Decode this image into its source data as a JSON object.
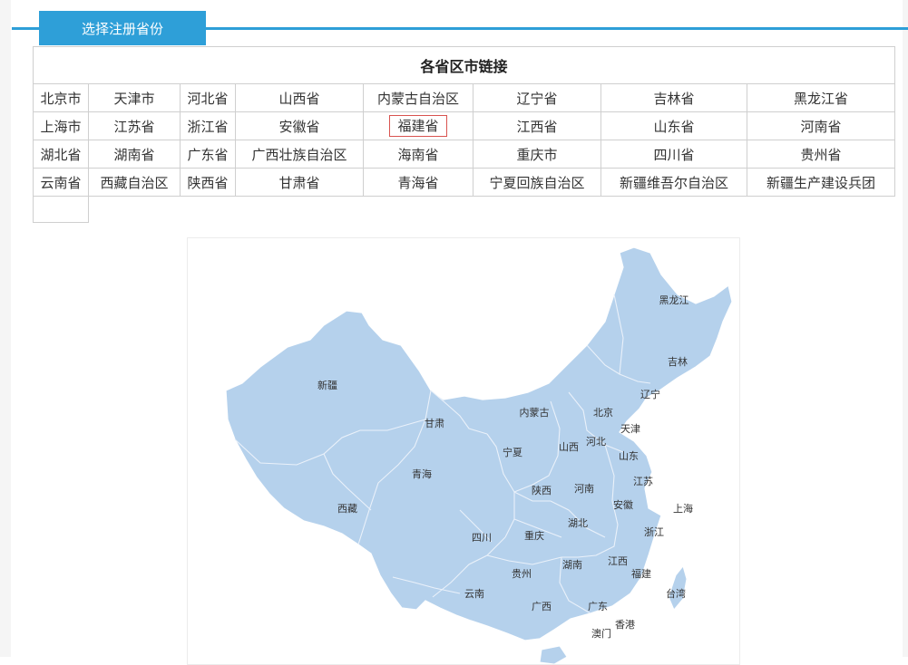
{
  "tab": {
    "label": "选择注册省份"
  },
  "table": {
    "title": "各省区市链接",
    "rows": [
      [
        "北京市",
        "天津市",
        "河北省",
        "山西省",
        "内蒙古自治区",
        "辽宁省",
        "吉林省",
        "黑龙江省"
      ],
      [
        "上海市",
        "江苏省",
        "浙江省",
        "安徽省",
        "福建省",
        "江西省",
        "山东省",
        "河南省"
      ],
      [
        "湖北省",
        "湖南省",
        "广东省",
        "广西壮族自治区",
        "海南省",
        "重庆市",
        "四川省",
        "贵州省"
      ],
      [
        "云南省",
        "西藏自治区",
        "陕西省",
        "甘肃省",
        "青海省",
        "宁夏回族自治区",
        "新疆维吾尔自治区",
        "新疆生产建设兵团"
      ]
    ],
    "highlighted": "福建省"
  },
  "map": {
    "fill_color": "#b5d1ec",
    "border_color": "#e6eef8",
    "labels": {
      "heilongjiang": "黑龙江",
      "jilin": "吉林",
      "liaoning": "辽宁",
      "xinjiang": "新疆",
      "neimenggu": "内蒙古",
      "beijing": "北京",
      "tianjin": "天津",
      "gansu": "甘肃",
      "hebei": "河北",
      "ningxia": "宁夏",
      "shanxi": "山西",
      "shandong": "山东",
      "qinghai": "青海",
      "jiangsu": "江苏",
      "shaanxi": "陕西",
      "henan": "河南",
      "xizang": "西藏",
      "anhui": "安徽",
      "shanghai": "上海",
      "hubei": "湖北",
      "zhejiang": "浙江",
      "sichuan": "四川",
      "chongqing": "重庆",
      "guizhou": "贵州",
      "hunan": "湖南",
      "jiangxi": "江西",
      "fujian": "福建",
      "taiwan": "台湾",
      "yunnan": "云南",
      "guangxi": "广西",
      "guangdong": "广东",
      "xianggang": "香港",
      "aomen": "澳门"
    }
  }
}
